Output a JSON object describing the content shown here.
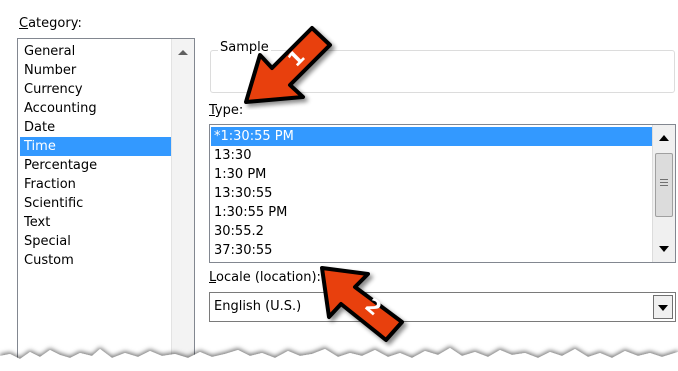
{
  "category": {
    "label_prefix": "C",
    "label_rest": "ategory:",
    "items": [
      "General",
      "Number",
      "Currency",
      "Accounting",
      "Date",
      "Time",
      "Percentage",
      "Fraction",
      "Scientific",
      "Text",
      "Special",
      "Custom"
    ],
    "selected_index": 5
  },
  "sample": {
    "label": "Sample",
    "value": ""
  },
  "type": {
    "label_prefix": "T",
    "label_rest": "ype:",
    "items": [
      "*1:30:55 PM",
      "13:30",
      "1:30 PM",
      "13:30:55",
      "1:30:55 PM",
      "30:55.2",
      "37:30:55"
    ],
    "selected_index": 0
  },
  "locale": {
    "label_prefix": "L",
    "label_rest": "ocale (location):",
    "value": "English (U.S.)"
  },
  "annotations": {
    "badge1": "1",
    "badge2": "2"
  },
  "colors": {
    "selection": "#3399ff",
    "annotation_arrow": "#e8400c"
  },
  "icons": [
    "chevron-up-icon",
    "scroll-up-icon",
    "scroll-down-icon",
    "dropdown-arrow-icon",
    "annotation-arrow-1",
    "annotation-arrow-2"
  ]
}
